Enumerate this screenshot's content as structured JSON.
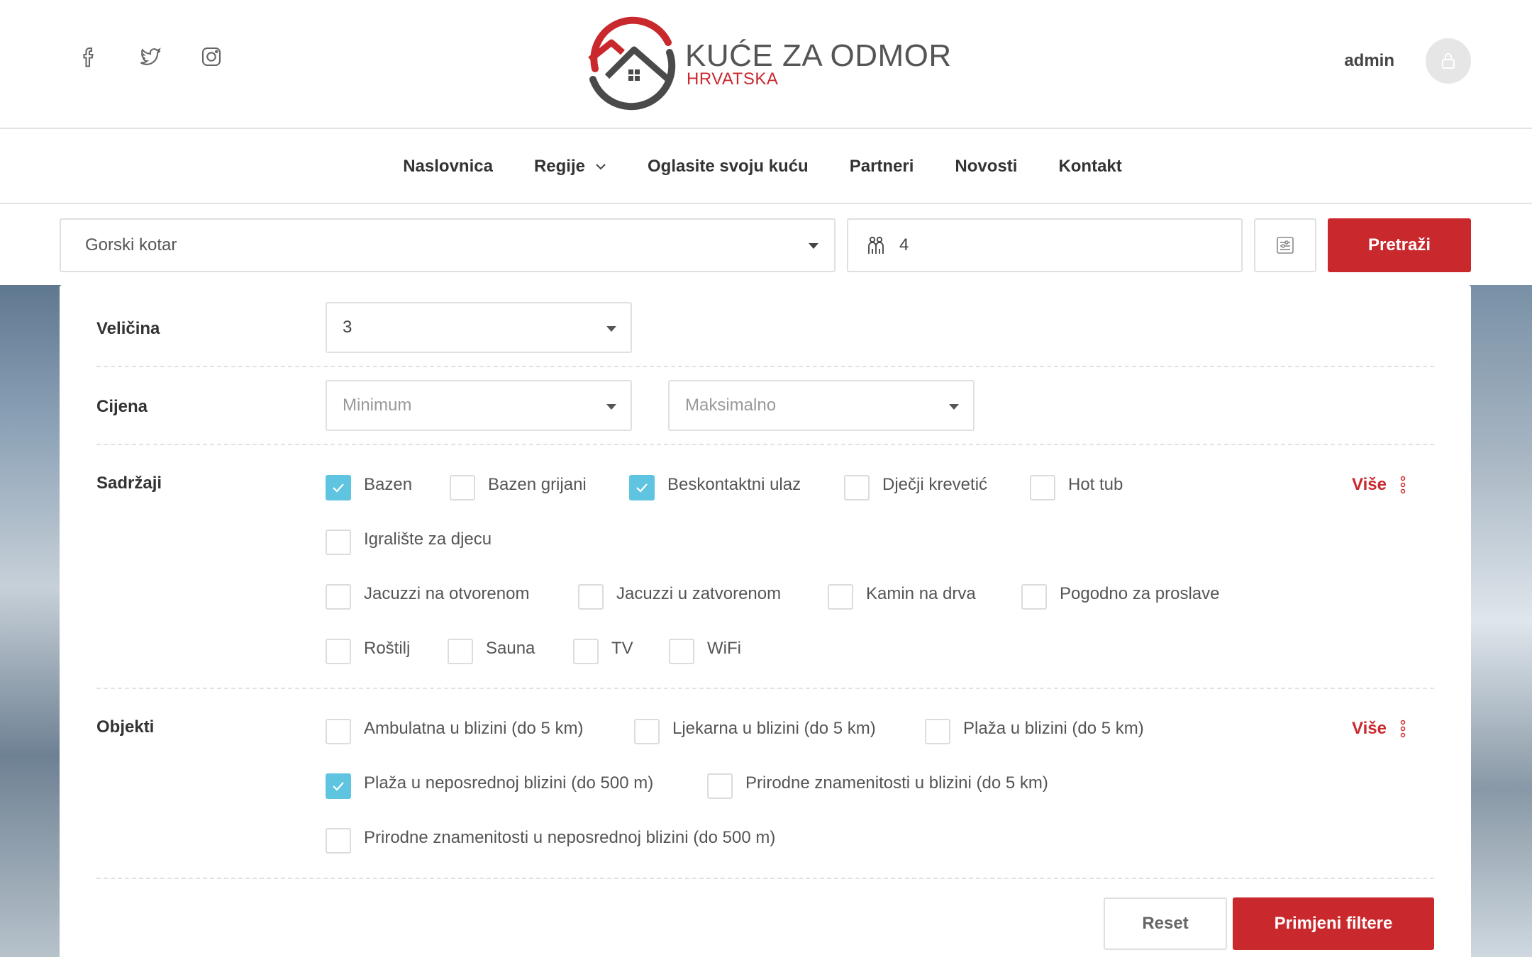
{
  "header": {
    "social": [
      {
        "icon": "facebook-icon"
      },
      {
        "icon": "twitter-icon"
      },
      {
        "icon": "instagram-icon"
      }
    ],
    "brand_title": "KUĆE ZA ODMOR",
    "brand_sub": "HRVATSKA",
    "username": "admin",
    "colors": {
      "accent": "#c9282d",
      "check": "#5ec4e0",
      "logo_gray": "#4a4a4a"
    }
  },
  "nav": {
    "items": [
      {
        "label": "Naslovnica"
      },
      {
        "label": "Regije"
      },
      {
        "label": "Oglasite svoju kuću"
      },
      {
        "label": "Partneri"
      },
      {
        "label": "Novosti"
      },
      {
        "label": "Kontakt"
      }
    ]
  },
  "search": {
    "region": "Gorski kotar",
    "guests": "4",
    "submit_label": "Pretraži"
  },
  "filters": {
    "size": {
      "label": "Veličina",
      "value": "3"
    },
    "price": {
      "label": "Cijena",
      "min_placeholder": "Minimum",
      "max_placeholder": "Maksimalno"
    },
    "amenities": {
      "label": "Sadržaji",
      "more_label": "Više",
      "items": [
        {
          "label": "Bazen",
          "checked": true
        },
        {
          "label": "Bazen grijani",
          "checked": false
        },
        {
          "label": "Beskontaktni ulaz",
          "checked": true
        },
        {
          "label": "Dječji krevetić",
          "checked": false
        },
        {
          "label": "Hot tub",
          "checked": false
        },
        {
          "label": "Igralište za djecu",
          "checked": false
        },
        {
          "label": "Jacuzzi na otvorenom",
          "checked": false
        },
        {
          "label": "Jacuzzi u zatvorenom",
          "checked": false
        },
        {
          "label": "Kamin na drva",
          "checked": false
        },
        {
          "label": "Pogodno za proslave",
          "checked": false
        },
        {
          "label": "Roštilj",
          "checked": false
        },
        {
          "label": "Sauna",
          "checked": false
        },
        {
          "label": "TV",
          "checked": false
        },
        {
          "label": "WiFi",
          "checked": false
        }
      ]
    },
    "facilities": {
      "label": "Objekti",
      "more_label": "Više",
      "items": [
        {
          "label": "Ambulatna u blizini (do 5 km)",
          "checked": false
        },
        {
          "label": "Ljekarna u blizini (do 5 km)",
          "checked": false
        },
        {
          "label": "Plaža u blizini (do 5 km)",
          "checked": false
        },
        {
          "label": "Plaža u neposrednoj blizini (do 500 m)",
          "checked": true
        },
        {
          "label": "Prirodne znamenitosti u blizini (do 5 km)",
          "checked": false
        },
        {
          "label": "Prirodne znamenitosti u neposrednoj blizini (do 500 m)",
          "checked": false
        }
      ]
    },
    "reset_label": "Reset",
    "apply_label": "Primjeni filtere"
  }
}
